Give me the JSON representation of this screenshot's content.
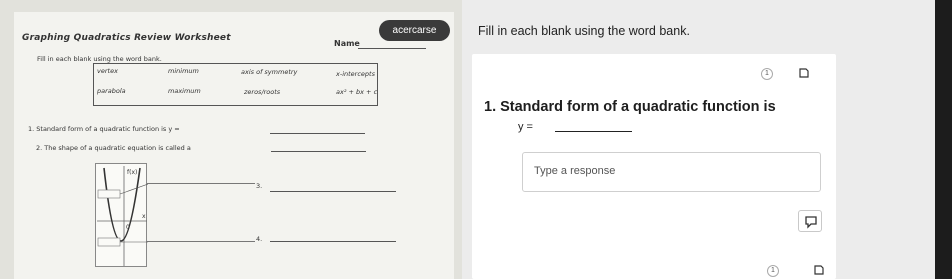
{
  "worksheet": {
    "title": "Graphing Quadratics Review Worksheet",
    "name_label": "Name",
    "instructions": "Fill in each blank using the word bank.",
    "word_bank": [
      "vertex",
      "minimum",
      "axis of symmetry",
      "x-intercepts",
      "parabola",
      "maximum",
      "zeros/roots",
      "ax² + bx + c"
    ],
    "q1": "1.  Standard form of a quadratic function is y = ",
    "q2": "2.  The shape of a quadratic equation is called a",
    "q3": "3.",
    "q4": "4.",
    "graph_label": "f(x)",
    "graph_x_label": "x",
    "graph_origin_label": "0"
  },
  "bubble": "acercarse",
  "panel": {
    "prompt": "Fill in each blank using the word bank.",
    "question_number_badge": "1",
    "question_title": "1.   Standard form of a quadratic function is",
    "equation_label": "y =",
    "response_placeholder": "Type a response",
    "page_number_badge": "1"
  },
  "icons": [
    "bookmark-icon",
    "annotation-icon",
    "bookmark-icon"
  ],
  "colors": {
    "bubble_bg": "#3a3a3a",
    "panel_bg": "#ececec",
    "card_bg": "#ffffff"
  }
}
